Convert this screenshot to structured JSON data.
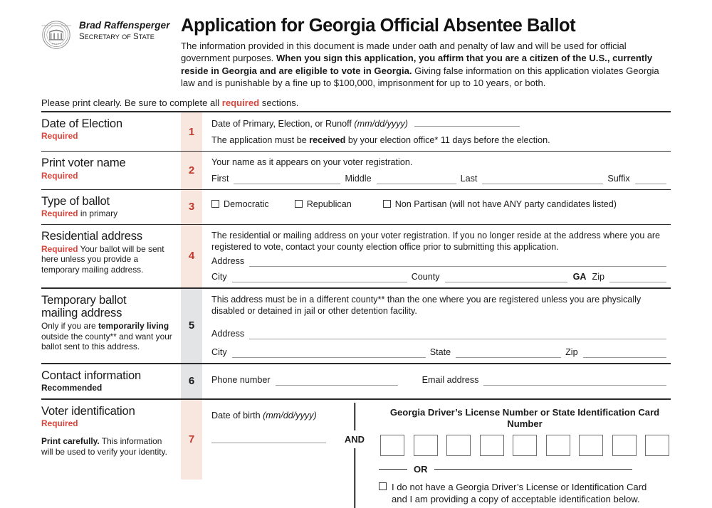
{
  "header": {
    "secretary_name": "Brad Raffensperger",
    "secretary_title_part1": "S",
    "secretary_title_part2": "ECRETARY",
    "secretary_title_part3": " OF ",
    "secretary_title_part4": "S",
    "secretary_title_part5": "TATE",
    "secretary_title_full": "SECRETARY OF STATE",
    "seal_icon": "georgia-state-seal",
    "title": "Application for Georgia Official Absentee Ballot",
    "intro_1": "The information provided in this document is made under oath and penalty of law and will be used for official government purposes. ",
    "intro_bold": "When you sign this application, you affirm that you are a citizen of the U.S., currently reside in Georgia and are eligible to vote in Georgia.",
    "intro_2": " Giving false information on this application violates Georgia law and is punishable by a fine up to $100,000, imprisonment for up to 10 years, or both.",
    "print_clearly_1": "Please print clearly. Be sure to complete all ",
    "print_clearly_required": "required",
    "print_clearly_2": " sections."
  },
  "colors": {
    "required_red": "#d9453d",
    "number_red": "#c0392f",
    "peach_box": "#f7e7de",
    "gray_box": "#e3e4e6",
    "rule_dark": "#2b2b2b",
    "field_line": "#9a9a9a"
  },
  "sections": [
    {
      "number": "1",
      "required": true,
      "heading": "Date of Election",
      "sub_required": "Required",
      "sub_rest": "",
      "note": "",
      "line1": "Date of Primary, Election, or Runoff ",
      "line1_italic": "(mm/dd/yyyy)",
      "line2_a": "The application must be ",
      "line2_b": "received",
      "line2_c": " by your election office* 11 days before the election."
    },
    {
      "number": "2",
      "required": true,
      "heading": "Print voter name",
      "sub_required": "Required",
      "sub_rest": "",
      "note": "",
      "intro": "Your name as it appears on your voter registration.",
      "fields": [
        "First",
        "Middle",
        "Last",
        "Suffix"
      ]
    },
    {
      "number": "3",
      "required": true,
      "heading": "Type of ballot",
      "sub_required": "Required",
      "sub_rest": " in primary",
      "note": "",
      "options": [
        "Democratic",
        "Republican",
        "Non Partisan (will not have ANY party candidates listed)"
      ]
    },
    {
      "number": "4",
      "required": true,
      "heading": "Residential address",
      "sub_required": "Required",
      "sub_rest": "  Your ballot will be sent here unless you provide a temporary mailing address.",
      "note": "",
      "intro": "The residential or mailing address on your voter registration. If you no longer reside at the address where you are registered to vote, contact your county election office prior to submitting this application.",
      "address_label": "Address",
      "city_label": "City",
      "county_label": "County",
      "state_value": "GA",
      "zip_label": "Zip"
    },
    {
      "number": "5",
      "required": false,
      "heading_line1": "Temporary ballot",
      "heading_line2": "mailing address",
      "sub_a": "Only if you are ",
      "sub_b": "temporarily living",
      "sub_c": " outside the county** and want your ballot sent to this address.",
      "intro": "This address must be in a different county** than the one where you are registered unless you are physically disabled or detained in jail or other detention facility.",
      "address_label": "Address",
      "city_label": "City",
      "state_label": "State",
      "zip_label": "Zip"
    },
    {
      "number": "6",
      "required": false,
      "heading": "Contact information",
      "sub_recommended": "Recommended",
      "phone_label": "Phone number",
      "email_label": "Email address"
    },
    {
      "number": "7",
      "required": true,
      "heading": "Voter identification",
      "sub_required": "Required",
      "note_bold": "Print carefully.",
      "note_rest": " This information will be used to verify your identity.",
      "dob_label": "Date of birth ",
      "dob_italic": "(mm/dd/yyyy)",
      "and_label": "AND",
      "dl_title": "Georgia Driver’s License Number or State Identification Card Number",
      "dl_box_count": 9,
      "or_label": "OR",
      "no_dl_line1": "I do not have a Georgia Driver’s License or Identification Card",
      "no_dl_line2": "and I am providing a copy of acceptable identification below."
    }
  ]
}
